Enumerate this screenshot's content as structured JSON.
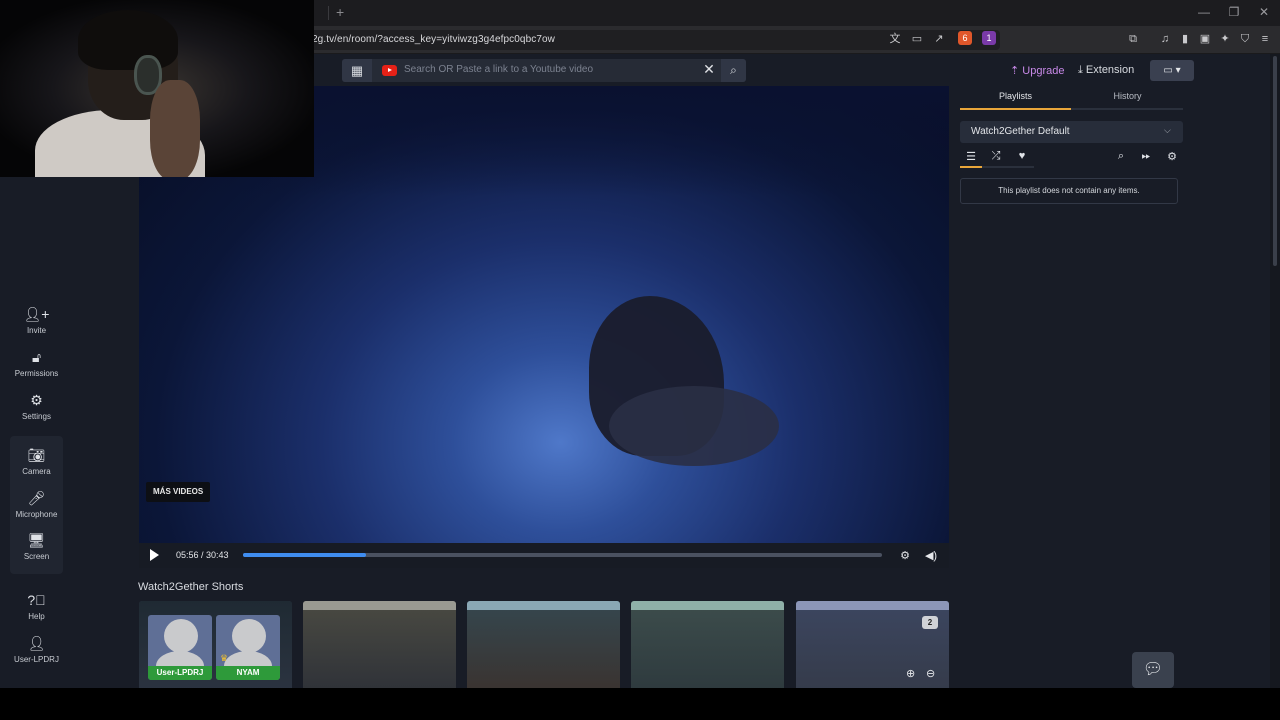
{
  "browser": {
    "url": "2g.tv/en/room/?access_key=yitviwzg3g4efpc0qbc7ow",
    "new_tab": "+",
    "window_minimize": "—",
    "window_restore": "❐",
    "window_close": "✕",
    "ext_badge_1": "6",
    "ext_badge_2": "1"
  },
  "search": {
    "placeholder": "Search OR Paste a link to a Youtube video"
  },
  "header": {
    "upgrade_label": "Upgrade",
    "extension_label": "Extension"
  },
  "sidebar": {
    "items": [
      {
        "label": "Invite",
        "icon": "add-user-icon"
      },
      {
        "label": "Permissions",
        "icon": "unlock-icon"
      },
      {
        "label": "Settings",
        "icon": "gear-icon"
      },
      {
        "label": "Camera",
        "icon": "camera-icon"
      },
      {
        "label": "Microphone",
        "icon": "microphone-icon"
      },
      {
        "label": "Screen",
        "icon": "monitor-icon"
      },
      {
        "label": "Help",
        "icon": "help-icon"
      },
      {
        "label": "User-LPDRJ",
        "icon": "user-icon"
      }
    ]
  },
  "player": {
    "overlay_label": "MÁS VIDEOS",
    "time": "05:56 / 30:43",
    "progress": 0.193
  },
  "shorts": {
    "title": "Watch2Gether Shorts",
    "count_badge": "2"
  },
  "users": [
    {
      "name": "User-LPDRJ"
    },
    {
      "name": "NYAM"
    }
  ],
  "right_panel": {
    "tabs": [
      "Playlists",
      "History"
    ],
    "active_tab": "Playlists",
    "playlist_name": "Watch2Gether Default",
    "empty_message": "This playlist does not contain any items."
  },
  "colors": {
    "accent": "#e8a63a",
    "upgrade": "#c889e8",
    "progress": "#3f8df0",
    "user_tag": "#2e9a3a"
  }
}
